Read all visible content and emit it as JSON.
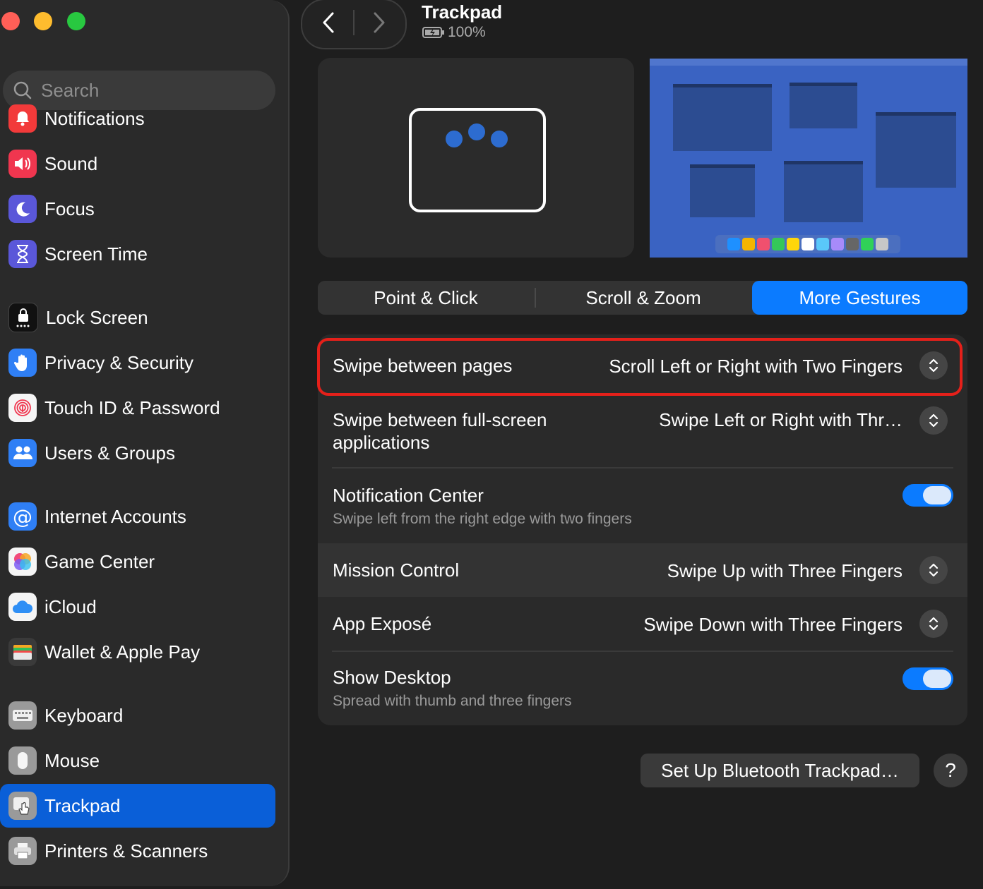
{
  "window": {
    "title": "Trackpad",
    "battery": "100%"
  },
  "sidebar": {
    "search_placeholder": "Search",
    "items": [
      {
        "label": "Notifications",
        "icon": "bell-icon",
        "color": "#f23a3a"
      },
      {
        "label": "Sound",
        "icon": "speaker-icon",
        "color": "#f0364f"
      },
      {
        "label": "Focus",
        "icon": "moon-icon",
        "color": "#5a57d9"
      },
      {
        "label": "Screen Time",
        "icon": "hourglass-icon",
        "color": "#5a57d9"
      },
      {
        "label": "Lock Screen",
        "icon": "lock-icon",
        "color": "#1a1a1a"
      },
      {
        "label": "Privacy & Security",
        "icon": "hand-icon",
        "color": "#2f7ff5"
      },
      {
        "label": "Touch ID & Password",
        "icon": "fingerprint-icon",
        "color": "#f5f5f5"
      },
      {
        "label": "Users & Groups",
        "icon": "users-icon",
        "color": "#2f7ff5"
      },
      {
        "label": "Internet Accounts",
        "icon": "at-icon",
        "color": "#2f7ff5"
      },
      {
        "label": "Game Center",
        "icon": "game-center-icon",
        "color": "#f5f5f5"
      },
      {
        "label": "iCloud",
        "icon": "cloud-icon",
        "color": "#f5f5f5"
      },
      {
        "label": "Wallet & Apple Pay",
        "icon": "wallet-icon",
        "color": "#3a3a3a"
      },
      {
        "label": "Keyboard",
        "icon": "keyboard-icon",
        "color": "#9a9a9a"
      },
      {
        "label": "Mouse",
        "icon": "mouse-icon",
        "color": "#9a9a9a"
      },
      {
        "label": "Trackpad",
        "icon": "trackpad-icon",
        "color": "#9a9a9a"
      },
      {
        "label": "Printers & Scanners",
        "icon": "printer-icon",
        "color": "#9a9a9a"
      }
    ],
    "selected": "Trackpad"
  },
  "tabs": [
    {
      "label": "Point & Click"
    },
    {
      "label": "Scroll & Zoom"
    },
    {
      "label": "More Gestures"
    }
  ],
  "active_tab": "More Gestures",
  "settings": [
    {
      "label": "Swipe between pages",
      "value": "Scroll Left or Right with Two Fingers",
      "control": "popup"
    },
    {
      "label": "Swipe between full-screen applications",
      "value": "Swipe Left or Right with Thr…",
      "control": "popup"
    },
    {
      "label": "Notification Center",
      "sub": "Swipe left from the right edge with two fingers",
      "control": "toggle",
      "on": true
    },
    {
      "label": "Mission Control",
      "value": "Swipe Up with Three Fingers",
      "control": "popup"
    },
    {
      "label": "App Exposé",
      "value": "Swipe Down with Three Fingers",
      "control": "popup"
    },
    {
      "label": "Show Desktop",
      "sub": "Spread with thumb and three fingers",
      "control": "toggle",
      "on": true
    }
  ],
  "footer": {
    "setup_button": "Set Up Bluetooth Trackpad…",
    "help_button": "?"
  },
  "colors": {
    "accent": "#0b7bff",
    "highlight_border": "#e5201a",
    "sidebar_selected": "#0a5fd8"
  }
}
